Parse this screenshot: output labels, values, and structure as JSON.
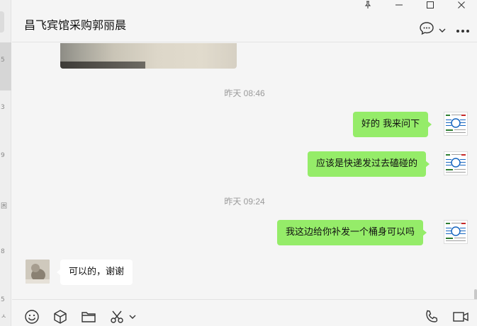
{
  "left_strip": {
    "fragments": [
      "5",
      "3",
      "9",
      "困",
      "8",
      "5",
      "ㅅ"
    ]
  },
  "header": {
    "title": "昌飞宾馆采购郭丽晨"
  },
  "messages": {
    "ts1": "昨天 08:46",
    "msg1": "好的 我来问下",
    "msg2": "应该是快递发过去磕碰的",
    "ts2": "昨天 09:24",
    "msg3": "我这边给你补发一个桶身可以吗",
    "msg4": "可以的，谢谢"
  },
  "colors": {
    "mine_bubble": "#95ec69",
    "other_bubble": "#ffffff",
    "background": "#f5f5f5"
  },
  "icons": [
    "pin-icon",
    "minimize-icon",
    "maximize-icon",
    "close-icon",
    "chat-bubble-icon",
    "chevron-down-icon",
    "more-icon",
    "emoji-icon",
    "cube-icon",
    "folder-icon",
    "scissors-icon",
    "phone-icon",
    "video-icon"
  ]
}
